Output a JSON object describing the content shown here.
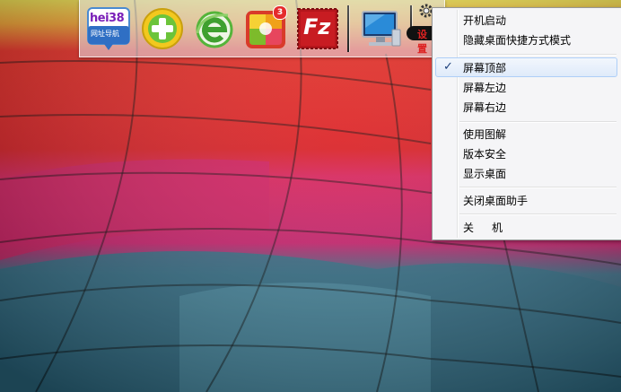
{
  "dock": {
    "icons": [
      {
        "name": "hei38",
        "label_top": "hei38",
        "label_bottom": "网址导航"
      },
      {
        "name": "360-plus"
      },
      {
        "name": "ie-browser"
      },
      {
        "name": "app-grid",
        "badge": "3"
      },
      {
        "name": "filezilla",
        "label": "Fz"
      },
      {
        "name": "computer"
      }
    ],
    "settings_label": "设置"
  },
  "menu": {
    "items": [
      {
        "label": "开机启动",
        "checked": false
      },
      {
        "label": "隐藏桌面快捷方式模式",
        "checked": false
      },
      {
        "label": "屏幕顶部",
        "checked": true
      },
      {
        "label": "屏幕左边",
        "checked": false
      },
      {
        "label": "屏幕右边",
        "checked": false
      },
      {
        "label": "使用图解",
        "checked": false
      },
      {
        "label": "版本安全",
        "checked": false
      },
      {
        "label": "显示桌面",
        "checked": false
      },
      {
        "label": "关闭桌面助手",
        "checked": false
      },
      {
        "label": "关机",
        "checked": false
      }
    ],
    "check_glyph": "✓"
  },
  "colors": {
    "menu_bg": "#f5f5f7",
    "menu_selected": "#dfeafa",
    "balloon_red": "#e0191c",
    "balloon_pink": "#d81f63",
    "balloon_teal": "#2f6e86"
  }
}
